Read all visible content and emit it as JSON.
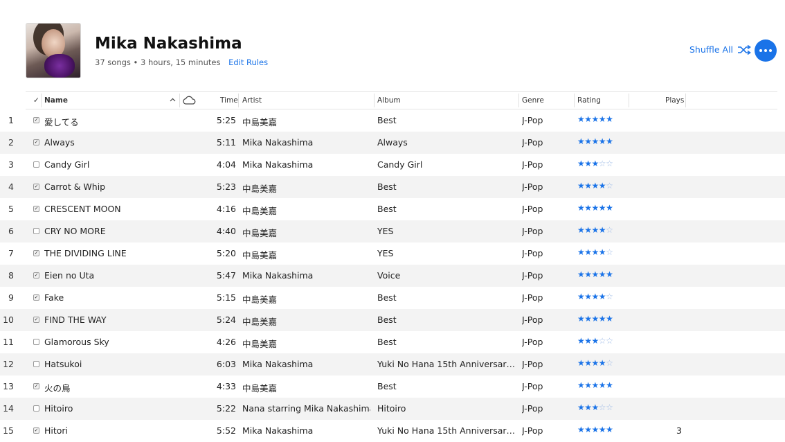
{
  "header": {
    "title": "Mika Nakashima",
    "summary": "37 songs • 3 hours, 15 minutes",
    "edit_rules": "Edit Rules",
    "shuffle_all": "Shuffle All"
  },
  "columns": {
    "check": "✓",
    "name": "Name",
    "time": "Time",
    "artist": "Artist",
    "album": "Album",
    "genre": "Genre",
    "rating": "Rating",
    "plays": "Plays"
  },
  "songs": [
    {
      "num": "1",
      "checked": true,
      "name": "愛してる",
      "time": "5:25",
      "artist": "中島美嘉",
      "album": "Best",
      "genre": "J-Pop",
      "rating": 5,
      "plays": ""
    },
    {
      "num": "2",
      "checked": true,
      "name": "Always",
      "time": "5:11",
      "artist": "Mika Nakashima",
      "album": "Always",
      "genre": "J-Pop",
      "rating": 5,
      "plays": ""
    },
    {
      "num": "3",
      "checked": false,
      "name": "Candy Girl",
      "time": "4:04",
      "artist": "Mika Nakashima",
      "album": "Candy Girl",
      "genre": "J-Pop",
      "rating": 3,
      "plays": ""
    },
    {
      "num": "4",
      "checked": true,
      "name": "Carrot & Whip",
      "time": "5:23",
      "artist": "中島美嘉",
      "album": "Best",
      "genre": "J-Pop",
      "rating": 4,
      "plays": ""
    },
    {
      "num": "5",
      "checked": true,
      "name": "CRESCENT MOON",
      "time": "4:16",
      "artist": "中島美嘉",
      "album": "Best",
      "genre": "J-Pop",
      "rating": 5,
      "plays": ""
    },
    {
      "num": "6",
      "checked": false,
      "name": "CRY NO MORE",
      "time": "4:40",
      "artist": "中島美嘉",
      "album": "YES",
      "genre": "J-Pop",
      "rating": 4,
      "plays": ""
    },
    {
      "num": "7",
      "checked": true,
      "name": "THE DIVIDING LINE",
      "time": "5:20",
      "artist": "中島美嘉",
      "album": "YES",
      "genre": "J-Pop",
      "rating": 4,
      "plays": ""
    },
    {
      "num": "8",
      "checked": true,
      "name": "Eien no Uta",
      "time": "5:47",
      "artist": "Mika Nakashima",
      "album": "Voice",
      "genre": "J-Pop",
      "rating": 5,
      "plays": ""
    },
    {
      "num": "9",
      "checked": true,
      "name": "Fake",
      "time": "5:15",
      "artist": "中島美嘉",
      "album": "Best",
      "genre": "J-Pop",
      "rating": 4,
      "plays": ""
    },
    {
      "num": "10",
      "checked": true,
      "name": "FIND THE WAY",
      "time": "5:24",
      "artist": "中島美嘉",
      "album": "Best",
      "genre": "J-Pop",
      "rating": 5,
      "plays": ""
    },
    {
      "num": "11",
      "checked": false,
      "name": "Glamorous Sky",
      "time": "4:26",
      "artist": "中島美嘉",
      "album": "Best",
      "genre": "J-Pop",
      "rating": 3,
      "plays": ""
    },
    {
      "num": "12",
      "checked": false,
      "name": "Hatsukoi",
      "time": "6:03",
      "artist": "Mika Nakashima",
      "album": "Yuki No Hana 15th Anniversary...",
      "genre": "J-Pop",
      "rating": 4,
      "plays": ""
    },
    {
      "num": "13",
      "checked": true,
      "name": "火の鳥",
      "time": "4:33",
      "artist": "中島美嘉",
      "album": "Best",
      "genre": "J-Pop",
      "rating": 5,
      "plays": ""
    },
    {
      "num": "14",
      "checked": false,
      "name": "Hitoiro",
      "time": "5:22",
      "artist": "Nana starring Mika Nakashima",
      "album": "Hitoiro",
      "genre": "J-Pop",
      "rating": 3,
      "plays": ""
    },
    {
      "num": "15",
      "checked": true,
      "name": "Hitori",
      "time": "5:52",
      "artist": "Mika Nakashima",
      "album": "Yuki No Hana 15th Anniversary...",
      "genre": "J-Pop",
      "rating": 5,
      "plays": "3"
    }
  ],
  "colors": {
    "accent": "#1a73e8",
    "stripe": "#f3f3f3"
  },
  "icons": [
    "shuffle-icon",
    "more-icon",
    "sort-up-icon",
    "cloud-icon"
  ]
}
